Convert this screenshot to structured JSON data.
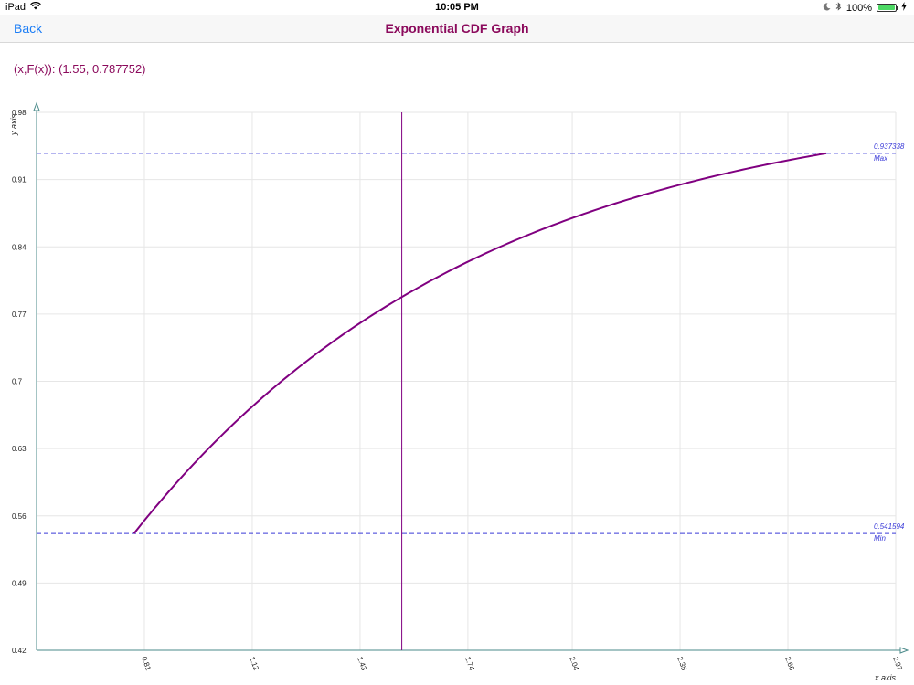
{
  "status_bar": {
    "device": "iPad",
    "time": "10:05 PM",
    "battery": "100%",
    "battery_level": 1.0
  },
  "nav": {
    "back_label": "Back",
    "title": "Exponential CDF Graph"
  },
  "readout": {
    "text": "(x,F(x)): (1.55, 0.787752)"
  },
  "colors": {
    "curve": "#800080",
    "reference_lines": "#3a3ad8",
    "title": "#8b0a5c",
    "back": "#1a7cf5",
    "grid": "#e6e6e6",
    "axis": "#4a8a8a"
  },
  "chart_data": {
    "type": "line",
    "xlabel": "x axis",
    "ylabel": "y axis",
    "xlim": [
      0.5,
      2.97
    ],
    "ylim": [
      0.42,
      0.98
    ],
    "x_ticks": [
      "0.81",
      "1.12",
      "1.43",
      "1.74",
      "2.04",
      "2.35",
      "2.66",
      "2.97"
    ],
    "y_ticks": [
      "0.42",
      "0.49",
      "0.56",
      "0.63",
      "0.7",
      "0.77",
      "0.84",
      "0.91",
      "0.98"
    ],
    "grid": true,
    "rate": 1.0,
    "x_range": [
      0.78,
      2.77
    ],
    "cursor": {
      "x": 1.55,
      "y": 0.787752
    },
    "reference_lines": [
      {
        "value": 0.937338,
        "value_label": "0.937338",
        "label": "Max"
      },
      {
        "value": 0.541594,
        "value_label": "0.541594",
        "label": "Min"
      }
    ]
  }
}
